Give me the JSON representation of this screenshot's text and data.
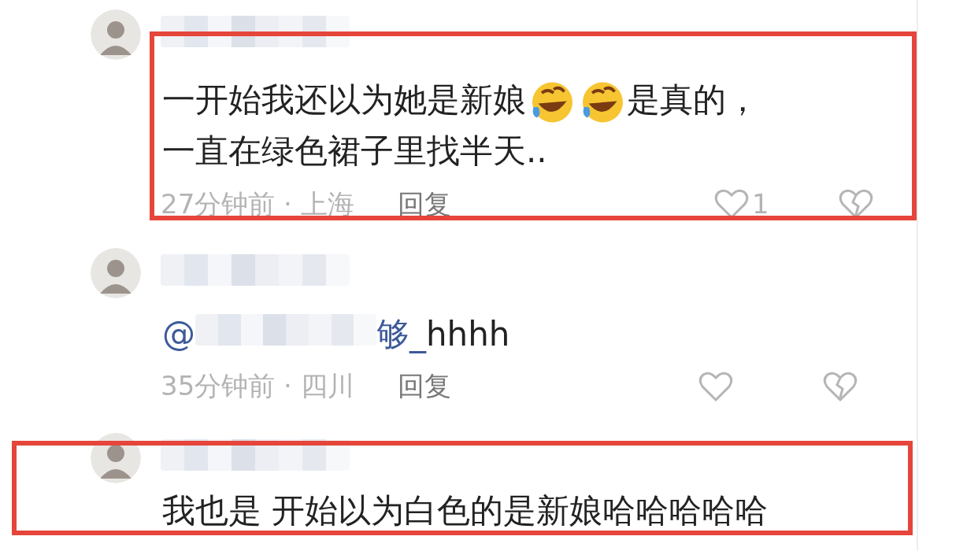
{
  "comments": [
    {
      "highlighted": true,
      "name_hidden": true,
      "parts": [
        {
          "kind": "text",
          "text": "一开始我还以为她是新娘"
        },
        {
          "kind": "emoji"
        },
        {
          "kind": "emoji"
        },
        {
          "kind": "text",
          "text": "是真的，"
        },
        {
          "kind": "break"
        },
        {
          "kind": "text",
          "text": "一直在绿色裙子里找半天.."
        }
      ],
      "meta": "27分钟前 · 上海",
      "reply": "回复",
      "likes": "1"
    },
    {
      "highlighted": false,
      "name_hidden": true,
      "parts": [
        {
          "kind": "mention",
          "text": "@"
        },
        {
          "kind": "redacted"
        },
        {
          "kind": "mention",
          "text": "够_"
        },
        {
          "kind": "text",
          "text": "hhhh"
        }
      ],
      "meta": "35分钟前 · 四川",
      "reply": "回复"
    },
    {
      "highlighted": true,
      "name_hidden": true,
      "parts": [
        {
          "kind": "text",
          "text": "我也是 开始以为白色的是新娘哈哈哈哈哈"
        }
      ]
    }
  ]
}
